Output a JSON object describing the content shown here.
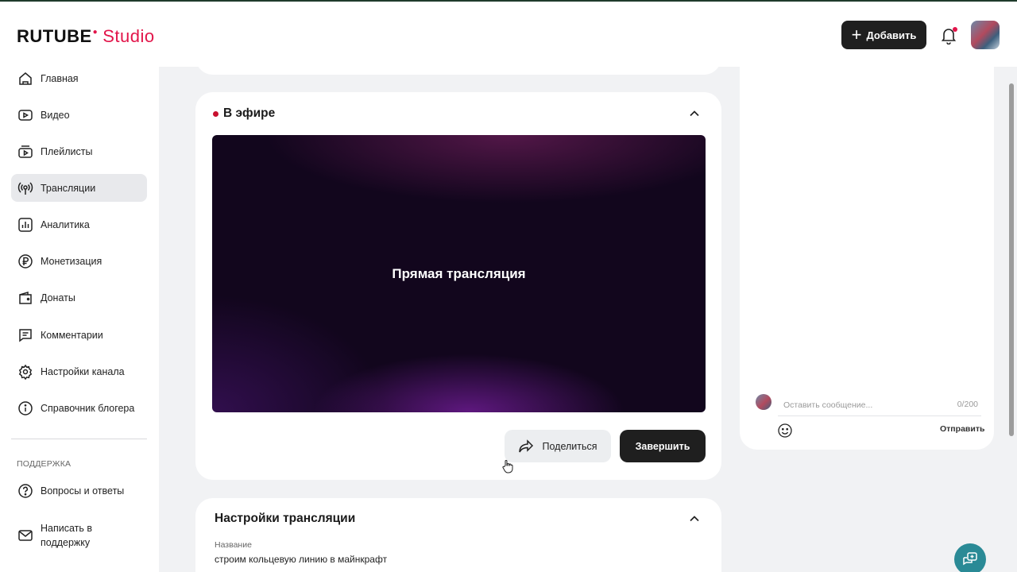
{
  "header": {
    "logo_main": "RUTUBE",
    "logo_sub": "Studio",
    "add_button": "Добавить"
  },
  "sidebar": {
    "items": [
      {
        "label": "Главная",
        "icon": "home-icon"
      },
      {
        "label": "Видео",
        "icon": "video-icon"
      },
      {
        "label": "Плейлисты",
        "icon": "playlist-icon"
      },
      {
        "label": "Трансляции",
        "icon": "broadcast-icon",
        "active": true
      },
      {
        "label": "Аналитика",
        "icon": "analytics-icon"
      },
      {
        "label": "Монетизация",
        "icon": "ruble-icon"
      },
      {
        "label": "Донаты",
        "icon": "wallet-icon"
      },
      {
        "label": "Комментарии",
        "icon": "comments-icon"
      },
      {
        "label": "Настройки канала",
        "icon": "gear-icon"
      },
      {
        "label": "Справочник блогера",
        "icon": "info-icon"
      }
    ],
    "support_label": "ПОДДЕРЖКА",
    "support_items": [
      {
        "label": "Вопросы и ответы",
        "icon": "question-icon"
      },
      {
        "label": "Написать в поддержку",
        "icon": "mail-icon"
      }
    ]
  },
  "live": {
    "title": "В эфире",
    "player_text": "Прямая трансляция",
    "share_button": "Поделиться",
    "finish_button": "Завершить"
  },
  "settings": {
    "title": "Настройки трансляции",
    "name_label": "Название",
    "name_value": "строим кольцевую линию в майнкрафт"
  },
  "chat": {
    "placeholder": "Оставить сообщение...",
    "counter": "0/200",
    "send_label": "Отправить"
  },
  "colors": {
    "accent": "#e2154a",
    "live_dot": "#c8102e",
    "dark_button": "#1f1f1f",
    "help_fab": "#2a8a96"
  }
}
